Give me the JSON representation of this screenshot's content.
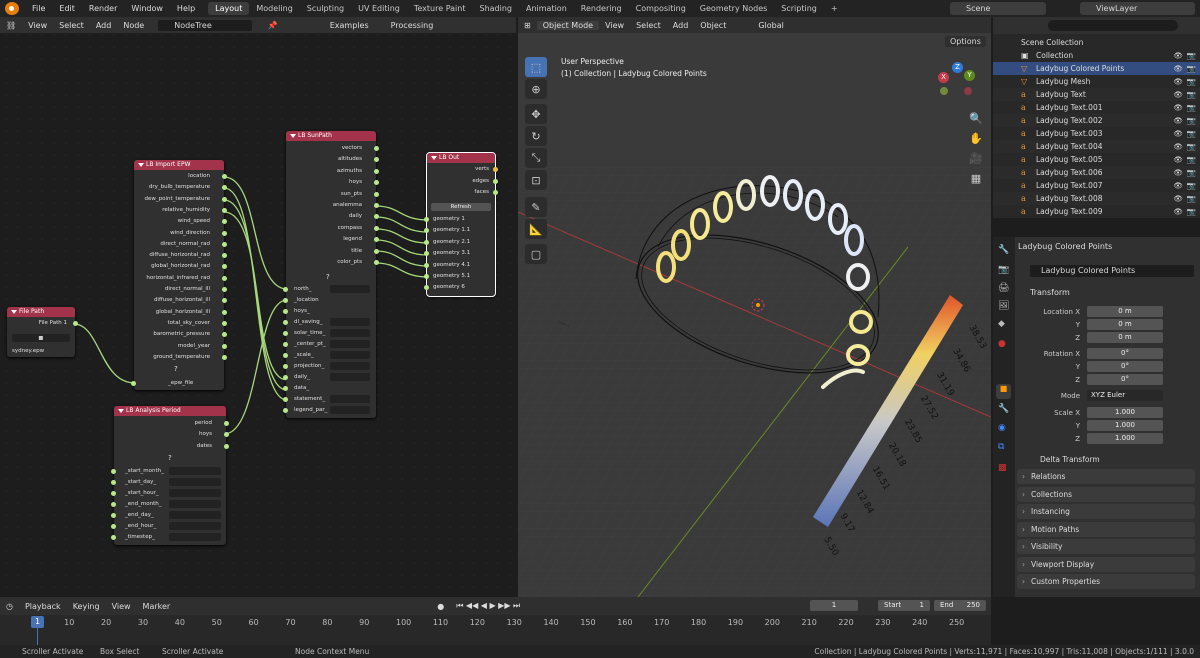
{
  "topbar": {
    "menus": [
      "File",
      "Edit",
      "Render",
      "Window",
      "Help"
    ],
    "workspaces": [
      "Layout",
      "Modeling",
      "Sculpting",
      "UV Editing",
      "Texture Paint",
      "Shading",
      "Animation",
      "Rendering",
      "Compositing",
      "Geometry Nodes",
      "Scripting"
    ],
    "scene": "Scene",
    "view_layer": "ViewLayer",
    "plus": "+"
  },
  "node_editor": {
    "menus": [
      "View",
      "Select",
      "Add",
      "Node"
    ],
    "tree_name": "NodeTree",
    "examples": "Examples",
    "processing": "Processing"
  },
  "nodes": {
    "file_path": {
      "title": "File Path",
      "output": "File Path 1",
      "value": "sydney.epw"
    },
    "import_epw": {
      "title": "LB Import EPW",
      "outputs": [
        "location",
        "dry_bulb_temperature",
        "dew_point_temperature",
        "relative_humidity",
        "wind_speed",
        "wind_direction",
        "direct_normal_rad",
        "diffuse_horizontal_rad",
        "global_horizontal_rad",
        "horizontal_infrared_rad",
        "direct_normal_ill",
        "diffuse_horizontal_ill",
        "global_horizontal_ill",
        "total_sky_cover",
        "barometric_pressure",
        "model_year",
        "ground_temperature"
      ],
      "help": "?",
      "input": "_epw_file"
    },
    "sunpath": {
      "title": "LB SunPath",
      "outputs": [
        "vectors",
        "altitudes",
        "azimuths",
        "hoys",
        "sun_pts",
        "analemma",
        "daily",
        "compass",
        "legend",
        "title",
        "color_pts"
      ],
      "help": "?",
      "inputs": [
        "north_",
        "_location",
        "hoys_",
        "dl_saving_",
        "solar_time_",
        "_center_pt_",
        "_scale_",
        "projection_",
        "daily_",
        "data_",
        "statement_",
        "legend_par_"
      ]
    },
    "out": {
      "title": "LB Out",
      "outputs": [
        "verts",
        "edges",
        "faces"
      ],
      "refresh": "Refresh",
      "inputs": [
        "geometry 1",
        "geometry 1.1",
        "geometry 2.1",
        "geometry 3.1",
        "geometry 4.1",
        "geometry 5.1",
        "geometry 6"
      ]
    },
    "period": {
      "title": "LB Analysis Period",
      "outputs": [
        "period",
        "hoys",
        "dates"
      ],
      "help": "?",
      "inputs": [
        "_start_month_",
        "_start_day_",
        "_start_hour_",
        "_end_month_",
        "_end_day_",
        "_end_hour_",
        "_timestep_"
      ]
    }
  },
  "viewport": {
    "menus": [
      "Object Mode",
      "View",
      "Select",
      "Add",
      "Object"
    ],
    "orientation": "Global",
    "options": "Options",
    "perspective": "User Perspective",
    "collection_line": "(1) Collection | Ladybug Colored Points",
    "legend_values": [
      "5.50",
      "9.17",
      "12.84",
      "16.51",
      "20.18",
      "23.85",
      "27.52",
      "31.19",
      "34.86",
      "38.53"
    ],
    "gizmo": {
      "x": "X",
      "y": "Y",
      "z": "Z"
    }
  },
  "outliner": {
    "title": "Scene Collection",
    "rows": [
      "Collection",
      "Ladybug Colored Points",
      "Ladybug Mesh",
      "Ladybug Text",
      "Ladybug Text.001",
      "Ladybug Text.002",
      "Ladybug Text.003",
      "Ladybug Text.004",
      "Ladybug Text.005",
      "Ladybug Text.006",
      "Ladybug Text.007",
      "Ladybug Text.008",
      "Ladybug Text.009"
    ]
  },
  "properties": {
    "object_name": "Ladybug Colored Points",
    "object_field": "Ladybug Colored Points",
    "transform": "Transform",
    "location_label": "Location X",
    "rotation_label": "Rotation X",
    "scale_label": "Scale X",
    "axis_y": "Y",
    "axis_z": "Z",
    "location": [
      "0 m",
      "0 m",
      "0 m"
    ],
    "rotation": [
      "0°",
      "0°",
      "0°"
    ],
    "mode_label": "Mode",
    "mode": "XYZ Euler",
    "scale": [
      "1.000",
      "1.000",
      "1.000"
    ],
    "delta": "Delta Transform",
    "sections": [
      "Relations",
      "Collections",
      "Instancing",
      "Motion Paths",
      "Visibility",
      "Viewport Display",
      "Custom Properties"
    ]
  },
  "timeline": {
    "menus": [
      "Playback",
      "Keying",
      "View",
      "Marker"
    ],
    "current_frame": "1",
    "start_label": "Start",
    "start": "1",
    "end_label": "End",
    "end": "250",
    "ruler": [
      "1",
      "10",
      "20",
      "30",
      "40",
      "50",
      "60",
      "70",
      "80",
      "90",
      "100",
      "110",
      "120",
      "130",
      "140",
      "150",
      "160",
      "170",
      "180",
      "190",
      "200",
      "210",
      "220",
      "230",
      "240",
      "250"
    ]
  },
  "status": {
    "items": [
      "Scroller Activate",
      "Box Select",
      "Scroller Activate",
      "Node Context Menu"
    ],
    "stats": "Collection | Ladybug Colored Points | Verts:11,971 | Faces:10,997 | Tris:11,008 | Objects:1/111 | 3.0.0"
  }
}
